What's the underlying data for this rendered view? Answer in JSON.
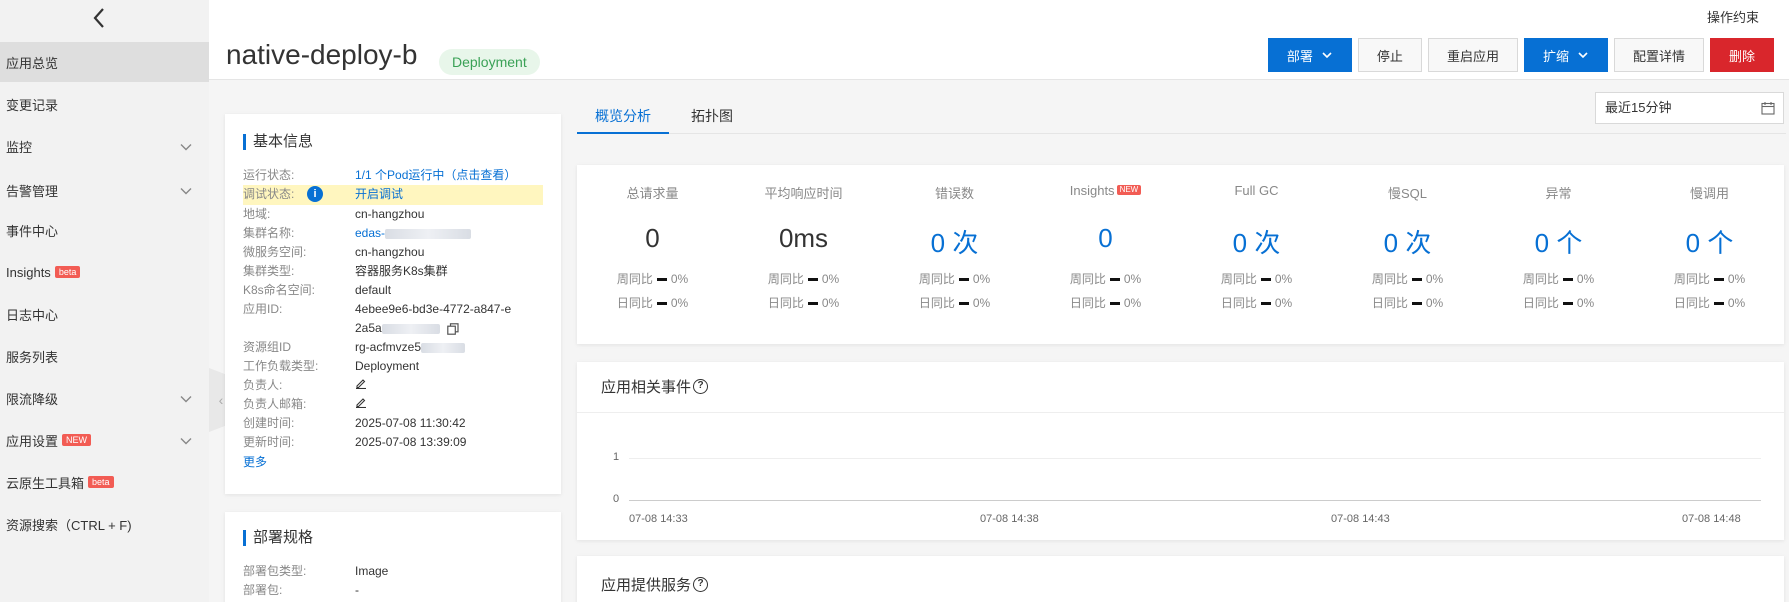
{
  "sidebar": {
    "items": [
      {
        "label": "应用总览",
        "active": true
      },
      {
        "label": "变更记录"
      },
      {
        "label": "监控",
        "expandable": true
      },
      {
        "label": "告警管理",
        "expandable": true
      },
      {
        "label": "事件中心"
      },
      {
        "label": "Insights",
        "badge": "beta"
      },
      {
        "label": "日志中心"
      },
      {
        "label": "服务列表"
      },
      {
        "label": "限流降级",
        "expandable": true
      },
      {
        "label": "应用设置",
        "badge": "NEW",
        "expandable": true
      },
      {
        "label": "云原生工具箱",
        "badge": "beta"
      },
      {
        "label": "资源搜索（CTRL + F)"
      }
    ]
  },
  "header": {
    "op_constraint": "操作约束",
    "title": "native-deploy-b",
    "tag": "Deployment",
    "buttons": {
      "deploy": "部署",
      "stop": "停止",
      "restart": "重启应用",
      "scale": "扩缩",
      "config": "配置详情",
      "delete": "删除"
    }
  },
  "basic_info": {
    "title": "基本信息",
    "run_status_label": "运行状态:",
    "run_status_value": "1/1 个Pod运行中（点击查看）",
    "debug_label": "调试状态:",
    "debug_value": "开启调试",
    "region_label": "地域:",
    "region_value": "cn-hangzhou",
    "cluster_label": "集群名称:",
    "cluster_value": "edas-",
    "ms_ns_label": "微服务空间:",
    "ms_ns_value": "cn-hangzhou",
    "cluster_type_label": "集群类型:",
    "cluster_type_value": "容器服务K8s集群",
    "k8s_ns_label": "K8s命名空间:",
    "k8s_ns_value": "default",
    "app_id_label": "应用ID:",
    "app_id_line1": "4ebee9e6-bd3e-4772-a847-e",
    "app_id_line2": "2a5a",
    "rg_label": "资源组ID",
    "rg_value": "rg-acfmvze5",
    "workload_label": "工作负载类型:",
    "workload_value": "Deployment",
    "owner_label": "负责人:",
    "owner_email_label": "负责人邮箱:",
    "created_label": "创建时间:",
    "created_value": "2025-07-08 11:30:42",
    "updated_label": "更新时间:",
    "updated_value": "2025-07-08 13:39:09",
    "more": "更多"
  },
  "deploy_spec": {
    "title": "部署规格",
    "pkg_type_label": "部署包类型:",
    "pkg_type_value": "Image",
    "pkg_label": "部署包:",
    "pkg_value": "-"
  },
  "tabs": [
    {
      "label": "概览分析",
      "active": true
    },
    {
      "label": "拓扑图"
    }
  ],
  "time_range": "最近15分钟",
  "metrics": [
    {
      "label": "总请求量",
      "value": "0",
      "blue": false,
      "wow": "周同比",
      "dod": "日同比",
      "wow_pct": "0%",
      "dod_pct": "0%"
    },
    {
      "label": "平均响应时间",
      "value": "0ms",
      "blue": false,
      "wow": "周同比",
      "dod": "日同比",
      "wow_pct": "0%",
      "dod_pct": "0%"
    },
    {
      "label": "错误数",
      "value": "0 次",
      "blue": true,
      "wow": "周同比",
      "dod": "日同比",
      "wow_pct": "0%",
      "dod_pct": "0%"
    },
    {
      "label": "Insights",
      "badge": "NEW",
      "value": "0",
      "blue": true,
      "wow": "周同比",
      "dod": "日同比",
      "wow_pct": "0%",
      "dod_pct": "0%"
    },
    {
      "label": "Full GC",
      "value": "0 次",
      "blue": true,
      "wow": "周同比",
      "dod": "日同比",
      "wow_pct": "0%",
      "dod_pct": "0%"
    },
    {
      "label": "慢SQL",
      "value": "0 次",
      "blue": true,
      "wow": "周同比",
      "dod": "日同比",
      "wow_pct": "0%",
      "dod_pct": "0%"
    },
    {
      "label": "异常",
      "value": "0 个",
      "blue": true,
      "wow": "周同比",
      "dod": "日同比",
      "wow_pct": "0%",
      "dod_pct": "0%"
    },
    {
      "label": "慢调用",
      "value": "0 个",
      "blue": true,
      "wow": "周同比",
      "dod": "日同比",
      "wow_pct": "0%",
      "dod_pct": "0%"
    }
  ],
  "events": {
    "title": "应用相关事件",
    "y_ticks": [
      "1",
      "0"
    ],
    "x_ticks": [
      "07-08 14:33",
      "07-08 14:38",
      "07-08 14:43",
      "07-08 14:48"
    ]
  },
  "services": {
    "title": "应用提供服务"
  }
}
